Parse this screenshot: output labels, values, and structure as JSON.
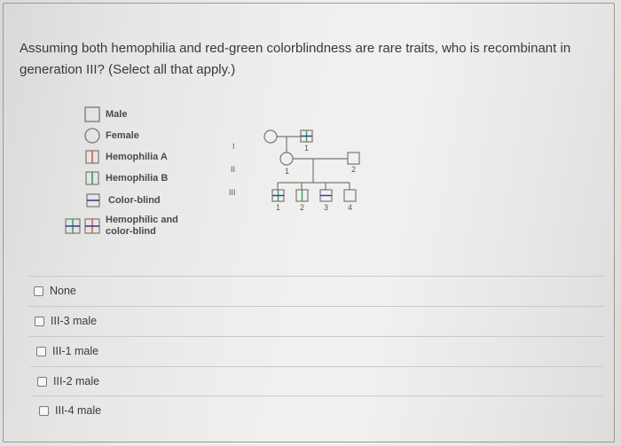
{
  "question": {
    "text": "Assuming both hemophilia and red-green colorblindness are rare traits, who is recombinant in generation III? (Select all that apply.)"
  },
  "legend": {
    "items": [
      {
        "symbol": "male-square",
        "label": "Male"
      },
      {
        "symbol": "female-circle",
        "label": "Female"
      },
      {
        "symbol": "hemophilia-a",
        "label": "Hemophilia A"
      },
      {
        "symbol": "hemophilia-b",
        "label": "Hemophilia B"
      },
      {
        "symbol": "color-blind",
        "label": "Color-blind"
      },
      {
        "symbol": "hemophilic-color-blind",
        "label": "Hemophilic and color-blind"
      }
    ],
    "label_line1": "Hemophilic and",
    "label_line2": "color-blind",
    "colors": {
      "hemophilia_a": "#e0553a",
      "hemophilia_b": "#2aa84a",
      "color_blind": "#3b3f9a",
      "outline": "#777777"
    }
  },
  "pedigree": {
    "generations": [
      "I",
      "II",
      "III"
    ],
    "individuals": {
      "I": [
        {
          "id": "",
          "sex": "female",
          "phenotype": "unaffected"
        },
        {
          "id": "1",
          "sex": "male",
          "phenotype": "hemophilia-b-and-color-blind"
        }
      ],
      "II": [
        {
          "id": "1",
          "sex": "female",
          "phenotype": "unaffected"
        },
        {
          "id": "2",
          "sex": "male",
          "phenotype": "unaffected"
        }
      ],
      "III": [
        {
          "id": "1",
          "sex": "male",
          "phenotype": "hemophilia-b-and-color-blind"
        },
        {
          "id": "2",
          "sex": "male",
          "phenotype": "hemophilia-b"
        },
        {
          "id": "3",
          "sex": "male",
          "phenotype": "color-blind"
        },
        {
          "id": "4",
          "sex": "male",
          "phenotype": "unaffected"
        }
      ]
    }
  },
  "options": [
    {
      "label": "None",
      "checked": false
    },
    {
      "label": "III-3 male",
      "checked": false
    },
    {
      "label": "III-1 male",
      "checked": false
    },
    {
      "label": "III-2 male",
      "checked": false
    },
    {
      "label": "III-4 male",
      "checked": false
    }
  ]
}
